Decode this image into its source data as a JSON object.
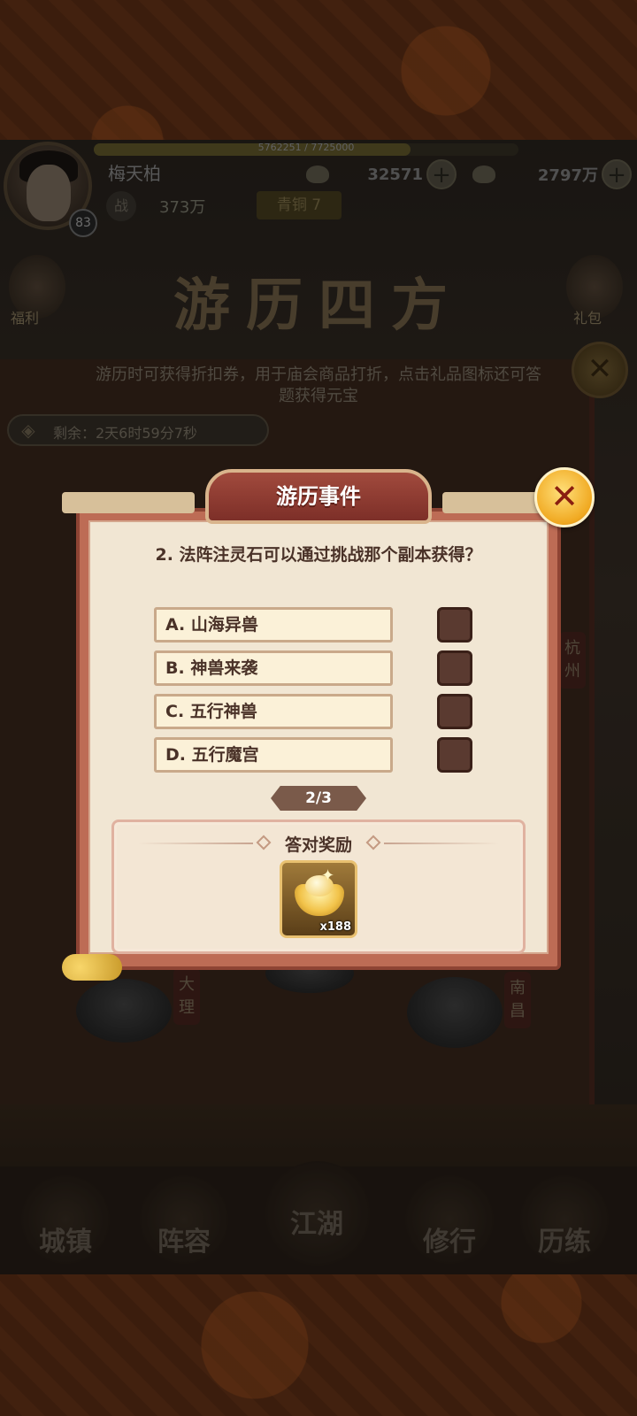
{
  "player": {
    "name": "梅天柏",
    "level": "83",
    "exp_text": "5762251 / 7725000",
    "exp_fraction": 0.746,
    "power_label": "战",
    "power": "373万",
    "vip": "青铜 7",
    "currency1": "32571",
    "currency2": "2797万",
    "plus": "+"
  },
  "side": {
    "left_label": "福利",
    "right_label": "礼包"
  },
  "banner": {
    "title": "游历四方",
    "description": "游历时可获得折扣券，用于庙会商品打折，点击礼品图标还可答题获得元宝",
    "close": "✕"
  },
  "timer": {
    "text": "剩余：2天6时59分7秒"
  },
  "cities": {
    "hangzhou": "杭州",
    "dali": "大理",
    "nanchang": "南昌"
  },
  "nav": [
    "城镇",
    "阵容",
    "江湖",
    "修行",
    "历练"
  ],
  "dialog": {
    "title": "游历事件",
    "close": "✕",
    "question": "2. 法阵注灵石可以通过挑战那个副本获得？",
    "options": [
      "A. 山海异兽",
      "B. 神兽来袭",
      "C. 五行神兽",
      "D. 五行魔宫"
    ],
    "page": "2/3",
    "reward_title": "答对奖励",
    "reward_count": "x188"
  },
  "colors": {
    "dialog_red": "#bd6c55",
    "dialog_paper": "#f1e6d3",
    "title_red": "#a14a3d",
    "gold": "#f0a820"
  }
}
